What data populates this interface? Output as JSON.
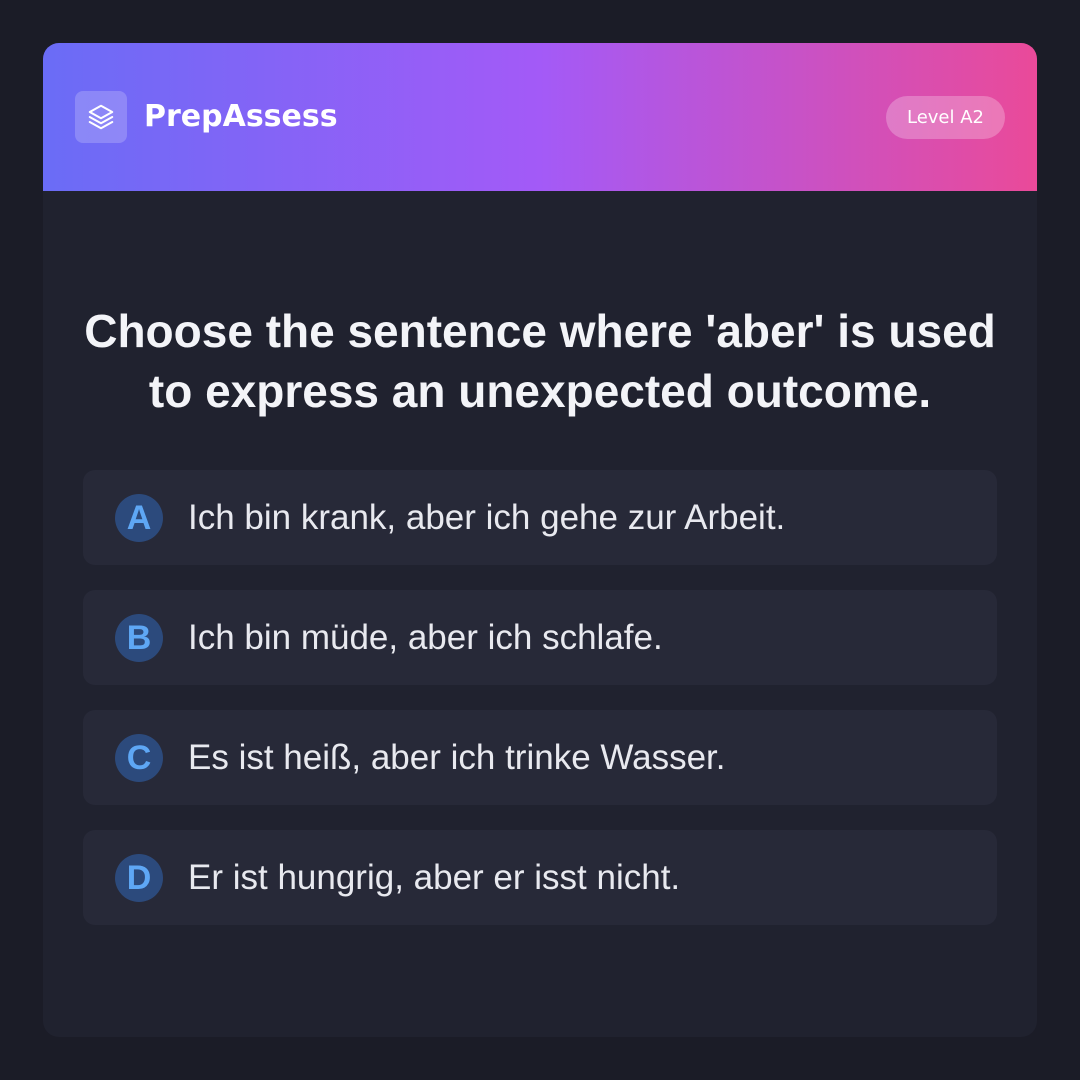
{
  "header": {
    "brand": "PrepAssess",
    "logo_icon": "layers-icon",
    "level": "Level A2"
  },
  "question": {
    "text": "Choose the sentence where 'aber' is used to express an unexpected outcome."
  },
  "options": [
    {
      "letter": "A",
      "text": "Ich bin krank, aber ich gehe zur Arbeit."
    },
    {
      "letter": "B",
      "text": "Ich bin müde, aber ich schlafe."
    },
    {
      "letter": "C",
      "text": "Es ist heiß, aber ich trinke Wasser."
    },
    {
      "letter": "D",
      "text": "Er ist hungrig, aber er isst nicht."
    }
  ],
  "colors": {
    "gradient_start": "#6a6cf6",
    "gradient_mid": "#a35af7",
    "gradient_end": "#ea4a99",
    "accent_letter": "#5ea7f5",
    "card_background": "#20222f",
    "option_background": "#272938"
  }
}
